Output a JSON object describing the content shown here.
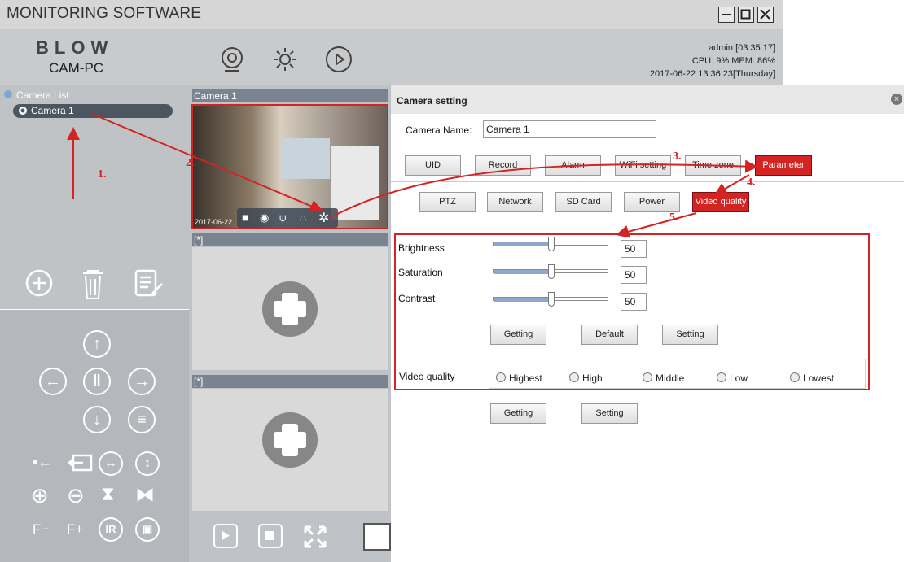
{
  "window": {
    "title": "MONITORING SOFTWARE"
  },
  "header": {
    "brand": "BLOW",
    "pc_name": "CAM-PC",
    "user_time": "admin  [03:35:17]",
    "cpu_mem": "CPU:  9%  MEM: 86%",
    "datetime": "2017-06-22 13:36:23[Thursday]",
    "icons": [
      "webcam-icon",
      "gear-icon",
      "play-icon"
    ]
  },
  "sidebar": {
    "camera_list_label": "Camera List",
    "camera_item": "Camera 1"
  },
  "ptz": {
    "rows": [
      [
        "up"
      ],
      [
        "left",
        "pause",
        "right"
      ],
      [
        "down",
        "menu"
      ],
      [
        "step-left",
        "width",
        "vertical"
      ],
      [
        "zoom-in",
        "zoom-out",
        "flip",
        "mirror"
      ]
    ],
    "focus_minus": "F−",
    "focus_plus": "F+",
    "ir_label": "IR"
  },
  "video": {
    "tiles": [
      {
        "title": "Camera 1",
        "timestamp": "2017-06-22"
      },
      {
        "title": "[*]"
      },
      {
        "title": "[*]"
      }
    ]
  },
  "settings": {
    "title": "Camera setting",
    "camera_name_label": "Camera Name:",
    "camera_name_value": "Camera 1",
    "tabs_row1": [
      "UID",
      "Record",
      "Alarm",
      "WiFi setting",
      "Time zone",
      "Parameter"
    ],
    "tabs_row2": [
      "PTZ",
      "Network",
      "SD Card",
      "Power",
      "Video quality"
    ],
    "sliders": [
      {
        "label": "Brightness",
        "value": "50"
      },
      {
        "label": "Saturation",
        "value": "50"
      },
      {
        "label": "Contrast",
        "value": "50"
      }
    ],
    "buttons1": [
      "Getting",
      "Default",
      "Setting"
    ],
    "video_quality_label": "Video quality",
    "quality_options": [
      "Highest",
      "High",
      "Middle",
      "Low",
      "Lowest"
    ],
    "buttons2": [
      "Getting",
      "Setting"
    ]
  },
  "annotations": [
    "1.",
    "2.",
    "3.",
    "4.",
    "5."
  ],
  "accent_color": "#d42323"
}
